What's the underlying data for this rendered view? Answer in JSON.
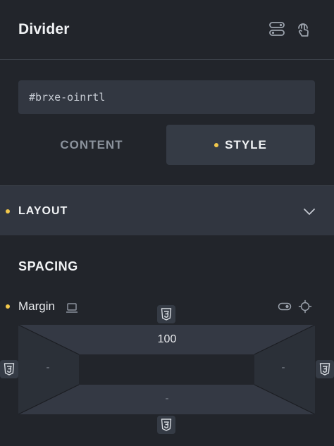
{
  "header": {
    "title": "Divider",
    "icons": [
      "toggle-rows-icon",
      "pointer-hand-icon"
    ]
  },
  "selector": {
    "value": "#brxe-oinrtl"
  },
  "tabs": [
    {
      "label": "CONTENT",
      "active": false
    },
    {
      "label": "STYLE",
      "active": true
    }
  ],
  "section": {
    "label": "LAYOUT",
    "icon": "chevron-down-icon"
  },
  "spacing": {
    "title": "SPACING",
    "margin": {
      "label": "Margin",
      "top": "100",
      "left": "-",
      "right": "-",
      "bottom": "-"
    }
  },
  "colors": {
    "background": "#22252b",
    "panel": "#313640",
    "accent_dot": "#f2c84b",
    "active_tab": "#353b45",
    "input": "#323741"
  }
}
